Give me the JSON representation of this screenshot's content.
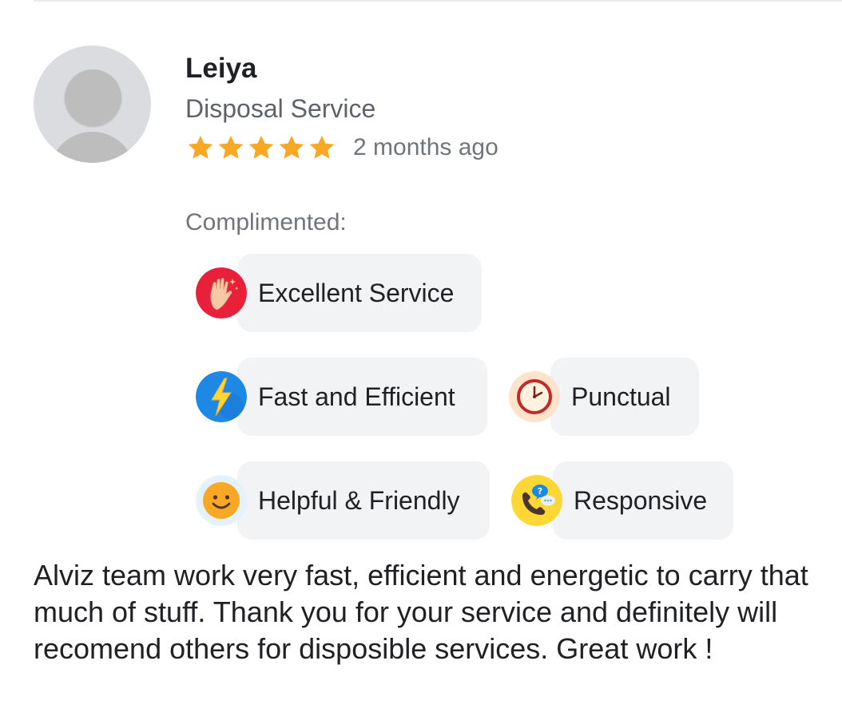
{
  "reviewer": {
    "name": "Leiya",
    "category": "Disposal Service",
    "rating": 5,
    "rating_max": 5,
    "time_ago": "2 months ago"
  },
  "compliments": {
    "label": "Complimented:",
    "items": [
      {
        "label": "Excellent Service",
        "icon": "waving-hand-icon",
        "color": "#e8203a"
      },
      {
        "label": "Fast and Efficient",
        "icon": "lightning-bolt-icon",
        "color": "#1e88e5"
      },
      {
        "label": "Punctual",
        "icon": "clock-icon",
        "color": "#c62828"
      },
      {
        "label": "Helpful & Friendly",
        "icon": "smiley-face-icon",
        "color": "#f9a825"
      },
      {
        "label": "Responsive",
        "icon": "phone-chat-icon",
        "color": "#fdd835"
      }
    ]
  },
  "review": {
    "text": "Alviz team work very fast, efficient and energetic to carry that much of stuff. Thank you for your service and definitely will recomend others for disposible services. Great work !"
  },
  "colors": {
    "star": "#f9a825",
    "chip_background": "#f1f3f4",
    "secondary_text": "#5f6368",
    "avatar_background": "#dadce0"
  }
}
